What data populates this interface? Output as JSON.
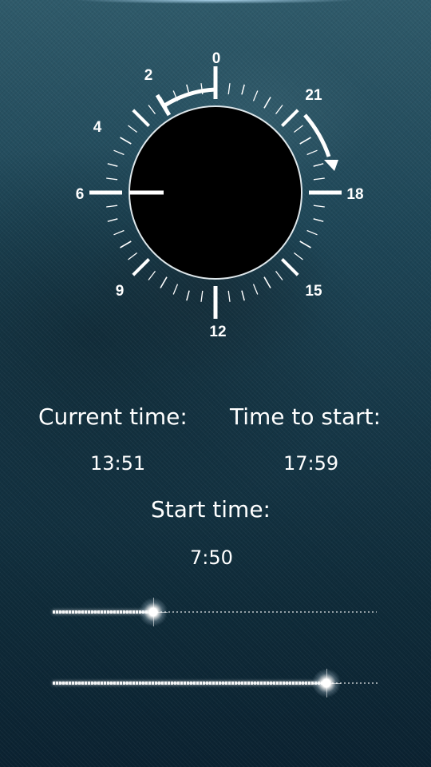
{
  "dial": {
    "numbers": [
      "0",
      "2",
      "4",
      "6",
      "9",
      "12",
      "15",
      "18",
      "21"
    ],
    "hand_hour": 18
  },
  "labels": {
    "current_time": "Current time:",
    "time_to_start": "Time to start:",
    "start_time": "Start time:"
  },
  "values": {
    "current_time": "13:51",
    "time_to_start": "17:59",
    "start_time": "7:50"
  },
  "sliders": [
    {
      "name": "hour-slider",
      "fraction": 0.31
    },
    {
      "name": "minute-slider",
      "fraction": 0.84
    }
  ]
}
